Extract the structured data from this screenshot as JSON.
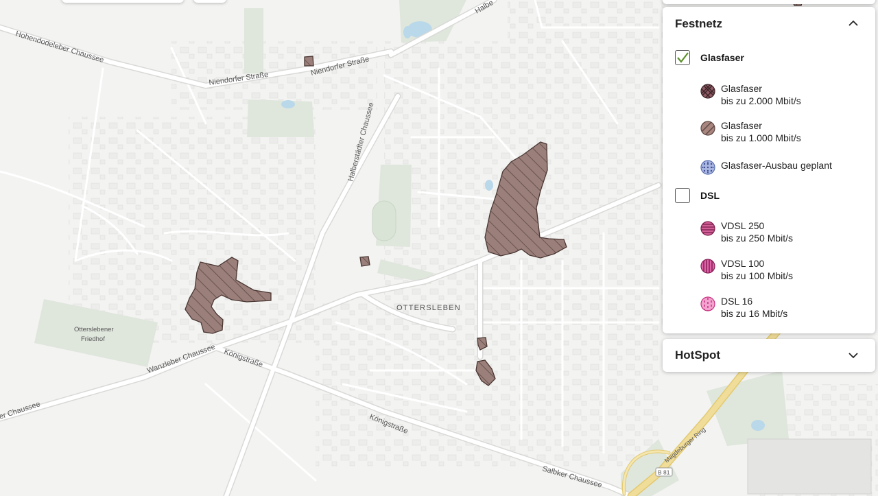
{
  "map": {
    "streets": {
      "hohendodeleber": "Hohendodeleber Chaussee",
      "niendorfer_1": "Niendorfer Straße",
      "niendorfer_2": "Niendorfer Straße",
      "halberstaedter": "Halberstädter Chaussee",
      "halbe": "Halbe",
      "wanzleber": "Wanzleber Chaussee",
      "koenig_1": "Königstraße",
      "koenig_2": "Königstraße",
      "chaussee_left": "er Chaussee",
      "salbker": "Salbker Chaussee",
      "ring": "Magdeburger Ring"
    },
    "places": {
      "district": "OTTERSLEBEN",
      "cemetery_1": "Otterslebener",
      "cemetery_2": "Friedhof"
    },
    "road_shield": "B 81",
    "colors": {
      "fiber_fill": "#9a7f7a",
      "fiber_stroke": "#4a3733",
      "background": "#f3f3f2",
      "green_area": "#dfe6dc",
      "water": "#b9d8ea",
      "highway": "#f0dd9a"
    }
  },
  "legend": {
    "festnetz": {
      "title": "Festnetz",
      "expanded_icon": "chevron-up-icon",
      "glasfaser": {
        "label": "Glasfaser",
        "checked": true,
        "items": [
          {
            "line1": "Glasfaser",
            "line2": "bis zu 2.000 Mbit/s",
            "icon": "crosshatch-icon",
            "color": "#8f5a63"
          },
          {
            "line1": "Glasfaser",
            "line2": "bis zu 1.000 Mbit/s",
            "icon": "diagonal-hatch-icon",
            "color": "#a8857f"
          },
          {
            "line1": "Glasfaser-Ausbau geplant",
            "line2": "",
            "icon": "dotted-icon",
            "color": "#5a6fb0"
          }
        ]
      },
      "dsl": {
        "label": "DSL",
        "checked": false,
        "items": [
          {
            "line1": "VDSL 250",
            "line2": "bis zu 250 Mbit/s",
            "icon": "horizontal-lines-icon",
            "color": "#c0447f"
          },
          {
            "line1": "VDSL 100",
            "line2": "bis zu 100 Mbit/s",
            "icon": "vertical-lines-icon",
            "color": "#d6408f"
          },
          {
            "line1": "DSL 16",
            "line2": "bis zu 16 Mbit/s",
            "icon": "dashed-icon",
            "color": "#e87ab8"
          }
        ]
      }
    },
    "hotspot": {
      "title": "HotSpot",
      "collapsed_icon": "chevron-down-icon"
    }
  }
}
